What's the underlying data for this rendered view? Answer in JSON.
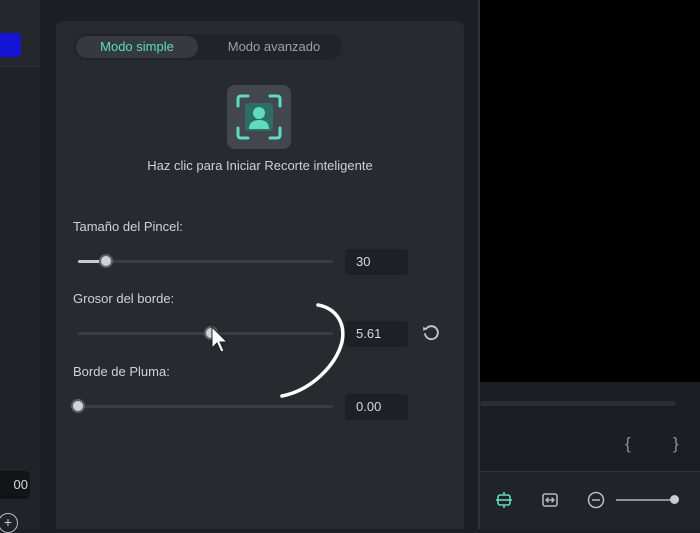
{
  "left_panel": {
    "field_value": "00",
    "plus_glyph": "+"
  },
  "tabs": [
    {
      "label": "Modo simple"
    },
    {
      "label": "Modo avanzado"
    }
  ],
  "smart_cutout": {
    "icon": "person-focus-icon",
    "caption": "Haz clic para Iniciar Recorte inteligente"
  },
  "sliders": {
    "brush_size": {
      "label": "Tamaño del Pincel:",
      "value": "30",
      "level": 0.11
    },
    "border_thickness": {
      "label": "Grosor del borde:",
      "value": "5.61",
      "level": 0.52
    },
    "feather": {
      "label": "Borde de Pluma:",
      "value": "0.00",
      "level": 0.0
    }
  },
  "right_panel": {
    "brace_left": "{",
    "brace_right": "}"
  },
  "colors": {
    "accent": "#5fdcc0",
    "panel": "#272a2f",
    "background": "#1c1f23",
    "left_highlight": "#1414d4"
  }
}
